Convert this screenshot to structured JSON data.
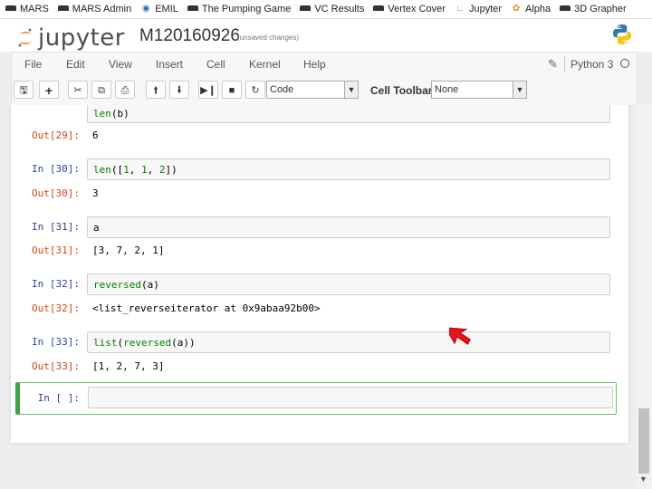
{
  "bookmarks": [
    {
      "label": "MARS",
      "icon": "hat-icon"
    },
    {
      "label": "MARS Admin",
      "icon": "hat-icon"
    },
    {
      "label": "EMIL",
      "icon": "globe-icon"
    },
    {
      "label": "The Pumping Game",
      "icon": "hat-icon"
    },
    {
      "label": "VC Results",
      "icon": "hat-icon"
    },
    {
      "label": "Vertex Cover",
      "icon": "hat-icon"
    },
    {
      "label": "Jupyter",
      "icon": "jupyter-icon"
    },
    {
      "label": "Alpha",
      "icon": "gear-icon"
    },
    {
      "label": "3D Grapher",
      "icon": "hat-icon"
    }
  ],
  "header": {
    "logo_text": "jupyter",
    "notebook_name": "M120160926",
    "status": "(unsaved changes)"
  },
  "menu": {
    "items": [
      "File",
      "Edit",
      "View",
      "Insert",
      "Cell",
      "Kernel",
      "Help"
    ],
    "kernel_name": "Python 3"
  },
  "toolbar": {
    "cell_type": "Code",
    "cell_toolbar_label": "Cell Toolbar:",
    "cell_toolbar_value": "None"
  },
  "cells": {
    "c28": {
      "code_fn": "len",
      "code_rest": "(b)"
    },
    "c29": {
      "out_prompt": "Out[29]:",
      "output": "6"
    },
    "c30": {
      "in_prompt": "In [30]:",
      "out_prompt": "Out[30]:",
      "output": "3",
      "code_fn": "len",
      "code_a": "([",
      "n1": "1",
      "sep1": ", ",
      "n2": "1",
      "sep2": ", ",
      "n3": "2",
      "code_b": "])"
    },
    "c31": {
      "in_prompt": "In [31]:",
      "out_prompt": "Out[31]:",
      "code": "a",
      "output": "[3, 7, 2, 1]"
    },
    "c32": {
      "in_prompt": "In [32]:",
      "out_prompt": "Out[32]:",
      "code_fn": "reversed",
      "code_rest": "(a)",
      "output": "<list_reverseiterator at 0x9abaa92b00>"
    },
    "c33": {
      "in_prompt": "In [33]:",
      "out_prompt": "Out[33]:",
      "code_fn1": "list",
      "code_p": "(",
      "code_fn2": "reversed",
      "code_rest": "(a))",
      "output": "[1, 2, 7, 3]"
    },
    "active": {
      "in_prompt": "In [ ]:",
      "code": ""
    }
  },
  "colors": {
    "in_prompt": "#303f9f",
    "out_prompt": "#d84315",
    "builtin": "#008000",
    "active_border": "#42a047",
    "cursor": "#e8141b"
  }
}
